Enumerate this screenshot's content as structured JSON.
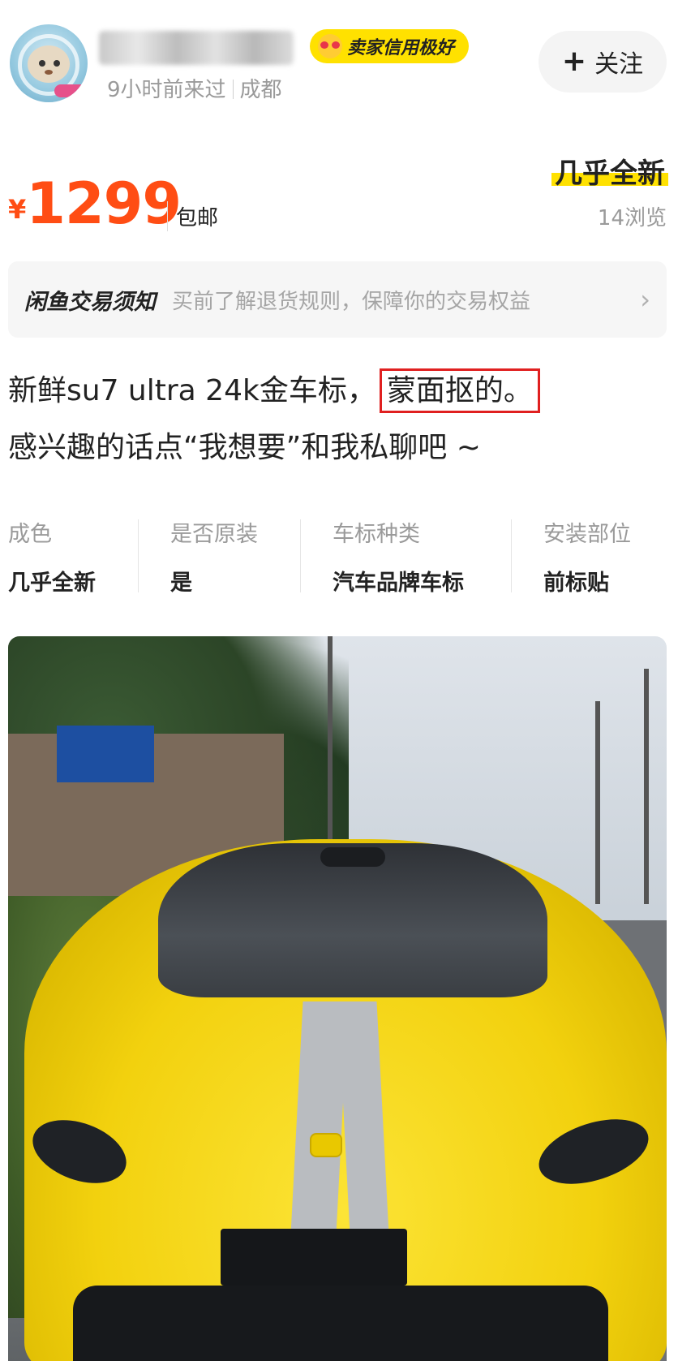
{
  "seller": {
    "name": "",
    "credit_badge": "卖家信用极好",
    "last_visit": "9小时前来过",
    "location": "成都",
    "follow_label": "关注"
  },
  "listing": {
    "price_symbol": "¥",
    "price": "1299",
    "shipping": "包邮",
    "condition": "几乎全新",
    "views": "14浏览"
  },
  "notice": {
    "title": "闲鱼交易须知",
    "text": "买前了解退货规则，保障你的交易权益"
  },
  "description": {
    "line1_prefix": "新鲜su7 ultra 24k金车标，",
    "line1_highlight": "蒙面抠的。",
    "line2": "感兴趣的话点“我想要”和我私聊吧 ~"
  },
  "attributes": [
    {
      "key": "成色",
      "value": "几乎全新"
    },
    {
      "key": "是否原装",
      "value": "是"
    },
    {
      "key": "车标种类",
      "value": "汽车品牌车标"
    },
    {
      "key": "安装部位",
      "value": "前标贴"
    }
  ],
  "colors": {
    "price": "#ff4d14",
    "brand_yellow": "#ffe100",
    "highlight_box": "#e02020"
  }
}
